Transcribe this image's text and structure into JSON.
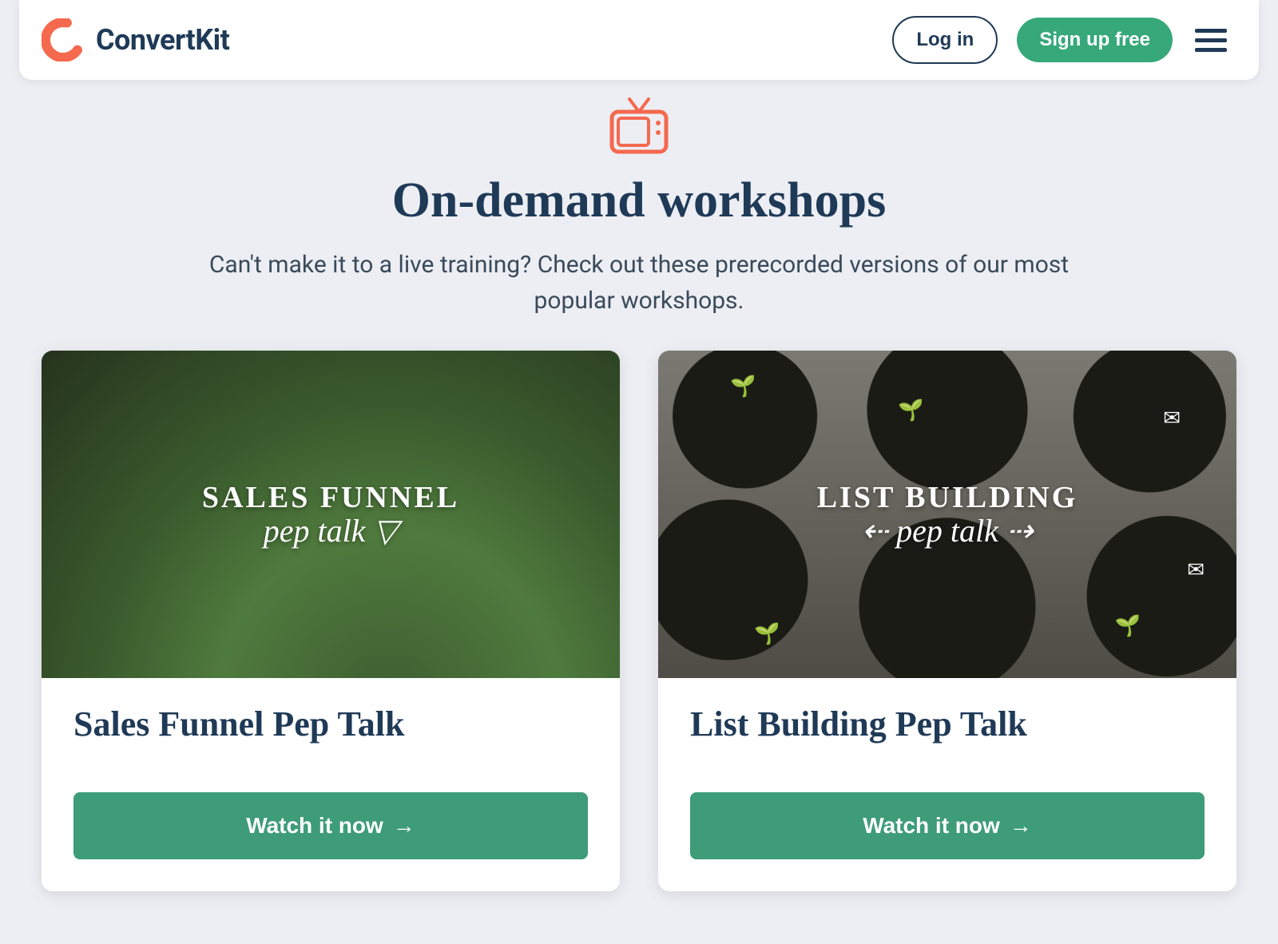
{
  "nav": {
    "brand": "ConvertKit",
    "login": "Log in",
    "signup": "Sign up free"
  },
  "hero": {
    "title": "On-demand workshops",
    "subtitle": "Can't make it to a live training? Check out these prerecorded versions of our most popular workshops."
  },
  "cards": [
    {
      "overlay_line1": "SALES FUNNEL",
      "overlay_line2": "pep talk",
      "title": "Sales Funnel Pep Talk",
      "cta": "Watch it now"
    },
    {
      "overlay_line1": "LIST BUILDING",
      "overlay_line2": "pep talk",
      "title": "List Building Pep Talk",
      "cta": "Watch it now"
    }
  ],
  "colors": {
    "accent_coral": "#f5694f",
    "accent_green": "#37a87a",
    "text_navy": "#1f3a57"
  }
}
